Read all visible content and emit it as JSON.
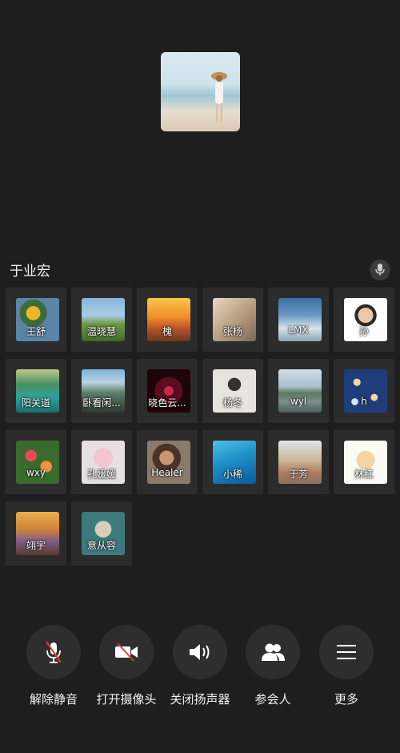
{
  "speaker": {
    "name": "于业宏"
  },
  "participants": [
    {
      "name": "王舒"
    },
    {
      "name": "温晓慧"
    },
    {
      "name": "槐"
    },
    {
      "name": "张杨"
    },
    {
      "name": "LMX"
    },
    {
      "name": "孙"
    },
    {
      "name": "阳关道"
    },
    {
      "name": "卧看闲..."
    },
    {
      "name": "晓色云..."
    },
    {
      "name": "杨冬"
    },
    {
      "name": "wyl"
    },
    {
      "name": "h"
    },
    {
      "name": "wxy"
    },
    {
      "name": "孔媛媛"
    },
    {
      "name": "Healer"
    },
    {
      "name": "小稀"
    },
    {
      "name": "于芳"
    },
    {
      "name": "林红"
    },
    {
      "name": "翊宇"
    },
    {
      "name": "意从容"
    }
  ],
  "controls": {
    "unmute": "解除静音",
    "camera": "打开摄像头",
    "speaker": "关闭扬声器",
    "participants": "参会人",
    "more": "更多"
  },
  "icons": {
    "unmute": "mic-off-icon",
    "camera": "camera-off-icon",
    "speaker": "speaker-icon",
    "participants": "people-icon",
    "more": "menu-icon"
  }
}
